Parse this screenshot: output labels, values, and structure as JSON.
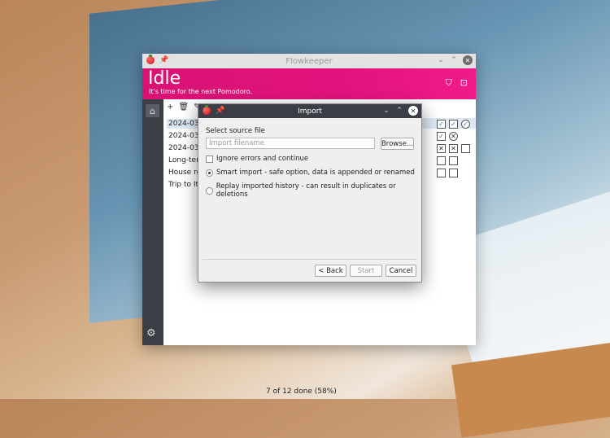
{
  "main_window": {
    "title": "Flowkeeper",
    "header": {
      "status": "Idle",
      "subtitle": "It's time for the next Pomodoro.",
      "filter_icon": "filter-icon",
      "toggle_icon": "layout-icon",
      "accent": "#e2137d"
    },
    "backlog_toolbar": [
      "+",
      "🗑",
      "✎"
    ],
    "backlogs": [
      "2024-03-",
      "2024-03-",
      "2024-03-",
      "Long-terr",
      "House re",
      "Trip to Ita"
    ],
    "progress_text": "7 of 12 done (58%)"
  },
  "dialog": {
    "title": "Import",
    "section_label": "Select source file",
    "filename_placeholder": "Import filename",
    "browse_label": "Browse...",
    "ignore_errors_label": "Ignore errors and continue",
    "smart_import_label": "Smart import - safe option, data is appended or renamed",
    "replay_label": "Replay imported history - can result in duplicates or deletions",
    "back_label": "< Back",
    "start_label": "Start",
    "cancel_label": "Cancel"
  }
}
